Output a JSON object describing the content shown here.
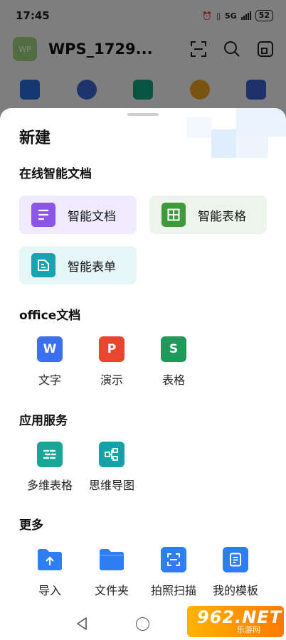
{
  "status_bar": {
    "time": "17:45",
    "network": "5G",
    "battery": "52"
  },
  "app_header": {
    "avatar_text": "WP",
    "title": "WPS_1729..."
  },
  "sheet": {
    "title": "新建",
    "online_section": {
      "title": "在线智能文档",
      "items": [
        {
          "label": "智能文档",
          "icon": "smart-doc-icon",
          "color": "#8b55e8",
          "bg": "#efeaff"
        },
        {
          "label": "智能表格",
          "icon": "smart-sheet-icon",
          "color": "#3e9a3c",
          "bg": "#ebf5ea"
        },
        {
          "label": "智能表单",
          "icon": "smart-form-icon",
          "color": "#16a3b0",
          "bg": "#e6f5f6"
        }
      ]
    },
    "office_section": {
      "title": "office文档",
      "items": [
        {
          "label": "文字",
          "glyph": "W",
          "icon": "word-icon",
          "color": "#3b6ff0"
        },
        {
          "label": "演示",
          "glyph": "P",
          "icon": "presentation-icon",
          "color": "#e8462e"
        },
        {
          "label": "表格",
          "glyph": "S",
          "icon": "spreadsheet-icon",
          "color": "#1f9a5b"
        }
      ]
    },
    "services_section": {
      "title": "应用服务",
      "items": [
        {
          "label": "多维表格",
          "icon": "multidim-table-icon",
          "color": "#17a596"
        },
        {
          "label": "思维导图",
          "icon": "mind-map-icon",
          "color": "#16a0a8"
        }
      ]
    },
    "more_section": {
      "title": "更多",
      "items": [
        {
          "label": "导入",
          "icon": "import-folder-icon",
          "color": "#2f7df2"
        },
        {
          "label": "文件夹",
          "icon": "folder-icon",
          "color": "#2f7df2"
        },
        {
          "label": "拍照扫描",
          "icon": "scan-icon",
          "color": "#2f7df2"
        },
        {
          "label": "我的模板",
          "icon": "template-icon",
          "color": "#2f7df2"
        }
      ]
    }
  },
  "watermark": {
    "main": "962.NET",
    "sub": "乐游网"
  }
}
